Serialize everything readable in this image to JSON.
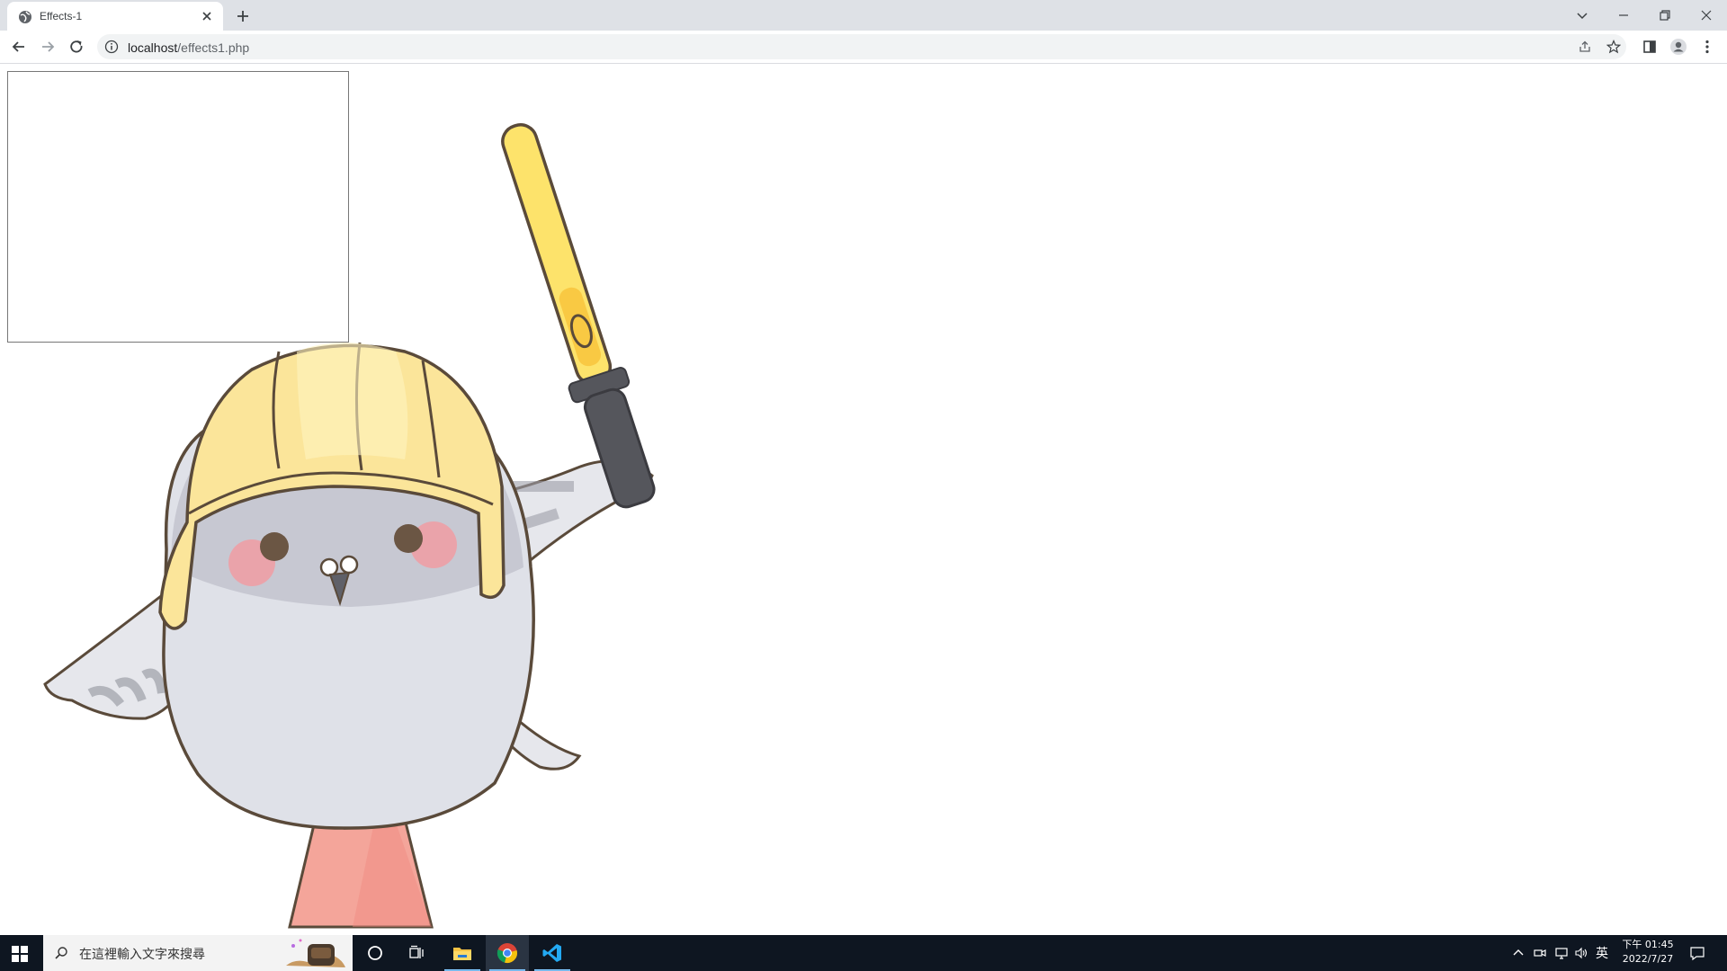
{
  "browser": {
    "tab": {
      "title": "Effects-1"
    },
    "address": {
      "host": "localhost",
      "path": "/effects1.php"
    }
  },
  "page": {
    "box": {
      "content": ""
    },
    "illustration": {
      "subject": "pigeon-hardhat-lightstick"
    }
  },
  "taskbar": {
    "search": {
      "placeholder": "在這裡輸入文字來搜尋"
    },
    "apps": [
      {
        "name": "file-explorer-icon",
        "active": true
      },
      {
        "name": "chrome-icon",
        "active": true
      },
      {
        "name": "vscode-icon",
        "active": true
      }
    ],
    "ime": "英",
    "clock": {
      "time": "下午 01:45",
      "date": "2022/7/27"
    }
  },
  "colors": {
    "tabstrip": "#dee1e6",
    "taskbar": "#0e1621",
    "helmet": "#fbe59a",
    "lightstick": "#fde36b",
    "body": "#dfe1e8",
    "head": "#c7c8d2",
    "cheek": "#f39aa0",
    "feet": "#f4a59a",
    "outline": "#5a4a3a"
  }
}
